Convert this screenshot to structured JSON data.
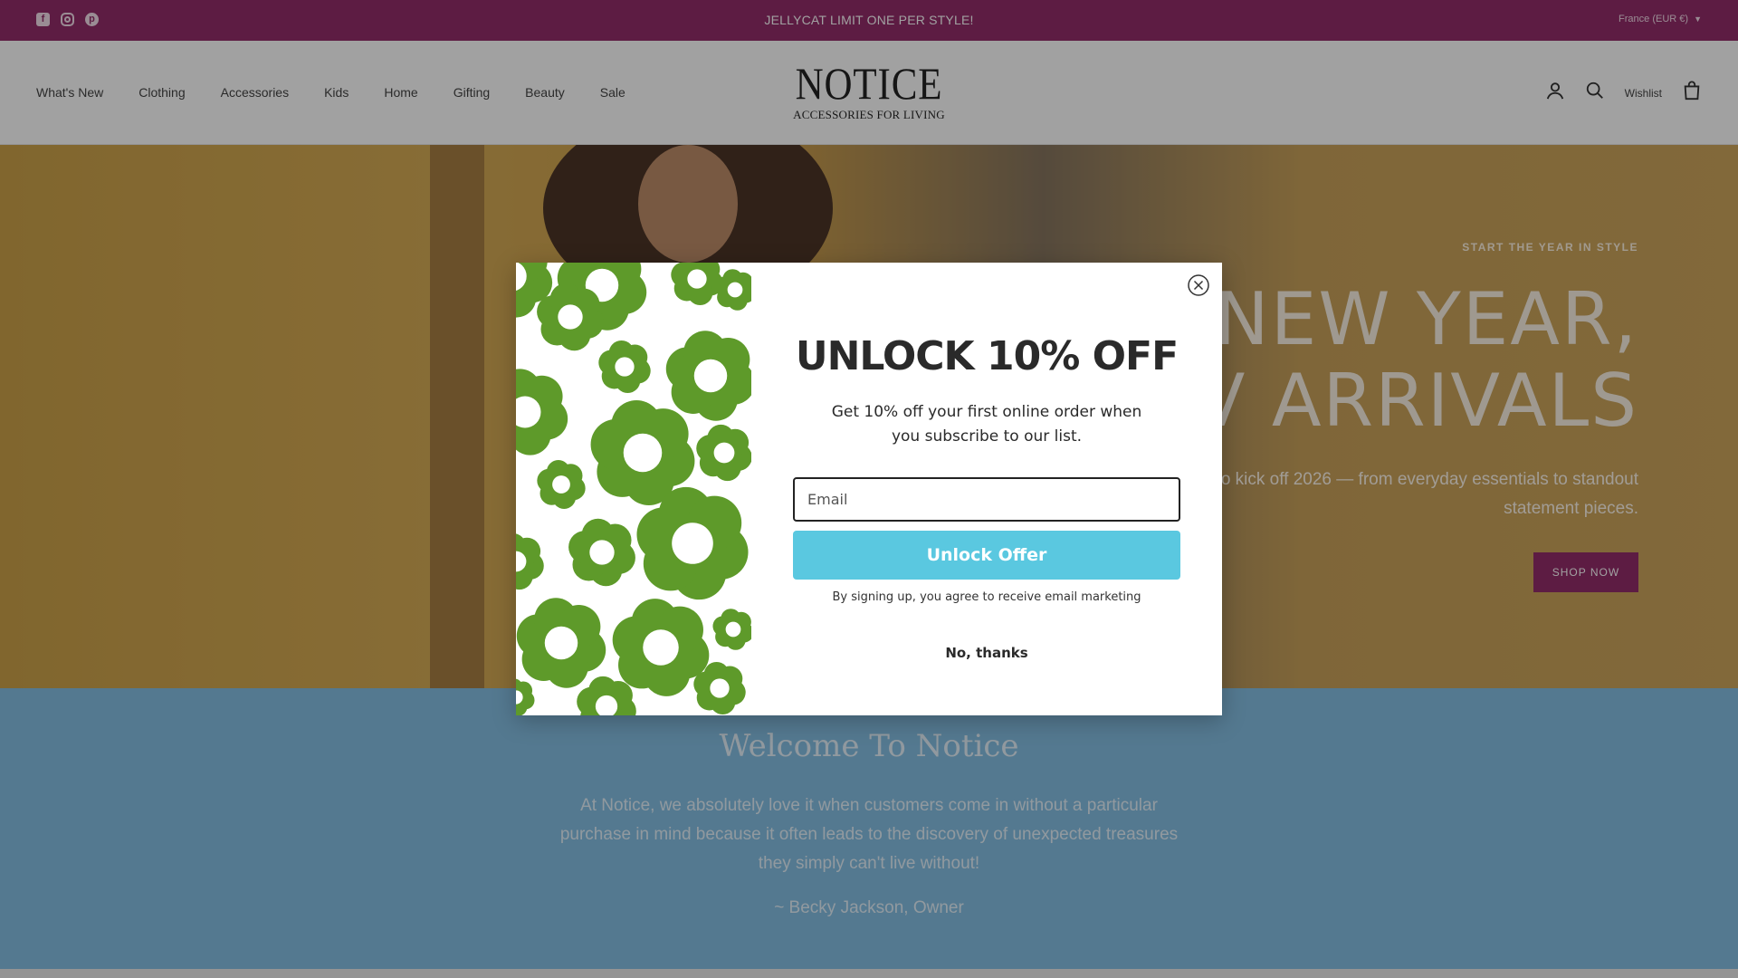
{
  "announcement": {
    "message": "JELLYCAT LIMIT ONE PER STYLE!",
    "country_selector": "France (EUR €)"
  },
  "header": {
    "logo_brand": "NOTICE",
    "logo_tagline": "ACCESSORIES FOR LIVING",
    "nav": [
      "What's New",
      "Clothing",
      "Accessories",
      "Kids",
      "Home",
      "Gifting",
      "Beauty",
      "Sale"
    ],
    "wishlist_label": "Wishlist"
  },
  "hero": {
    "kicker": "START THE YEAR IN STYLE",
    "headline_line1": "NEW YEAR,",
    "headline_line2": "V ARRIVALS",
    "subtext": "es to kick off 2026 — from everyday essentials to standout statement pieces.",
    "cta_label": "SHOP NOW"
  },
  "welcome": {
    "title": "Welcome To Notice",
    "paragraph": "At Notice, we absolutely love it when customers come in without a particular purchase in mind because it often leads to the discovery of unexpected treasures they simply can't live without!",
    "owner": "~ Becky Jackson, Owner"
  },
  "popup": {
    "title": "UNLOCK 10% OFF",
    "description": "Get 10% off your first online order when you subscribe to our list.",
    "email_placeholder": "Email",
    "button_label": "Unlock Offer",
    "legal": "By signing up, you agree to receive email marketing",
    "decline_label": "No, thanks"
  },
  "colors": {
    "brand_magenta": "#8a1a5e",
    "unlock_button": "#5ac8e0",
    "flower_green": "#5e9a2a",
    "welcome_blue": "#7bbbe2"
  },
  "icons": [
    "facebook-icon",
    "instagram-icon",
    "pinterest-icon",
    "chevron-down-icon",
    "account-icon",
    "search-icon",
    "cart-icon",
    "close-icon",
    "flower-pattern"
  ]
}
